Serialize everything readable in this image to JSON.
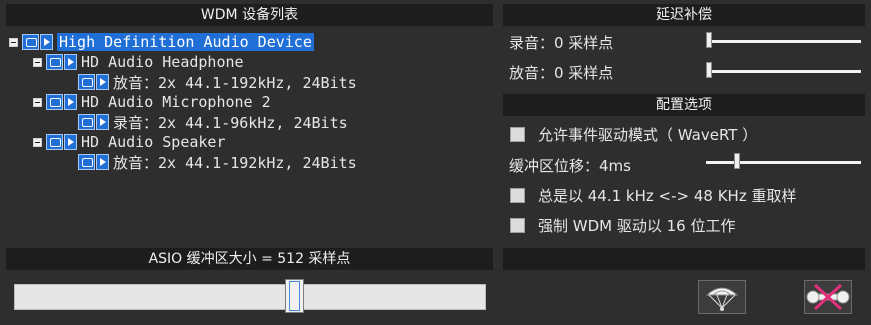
{
  "left_panel": {
    "title": "WDM 设备列表",
    "devices": [
      {
        "name": "High Definition Audio Device",
        "selected": true,
        "children": [
          {
            "name": "HD Audio Headphone",
            "detail": "放音：2x 44.1-192kHz, 24Bits"
          },
          {
            "name": "HD Audio Microphone 2",
            "detail": "录音：2x 44.1-96kHz, 24Bits"
          },
          {
            "name": "HD Audio Speaker",
            "detail": "放音：2x 44.1-192kHz, 24Bits"
          }
        ]
      }
    ]
  },
  "asio": {
    "title": "ASIO 缓冲区大小 = 512 采样点",
    "slider_fraction": 0.59
  },
  "latency": {
    "title": "延迟补偿",
    "record_label": "录音：0 采样点",
    "playback_label": "放音：0 采样点"
  },
  "config": {
    "title": "配置选项",
    "event_mode": "允许事件驱动模式（ WaveRT ）",
    "buffer_offset": "缓冲区位移：4ms",
    "resample": "总是以 44.1 kHz <-> 48 KHz 重取样",
    "force_16bit": "强制 WDM 驱动以 16 位工作"
  },
  "icons": {
    "device": "device-icon",
    "play": "play-icon",
    "parachute": "parachute-icon",
    "tools": "tools-remove-icon"
  },
  "colors": {
    "selection": "#1f6fd6",
    "header_bg": "#1d1d1d",
    "panel_bg": "#2e2e2e"
  }
}
